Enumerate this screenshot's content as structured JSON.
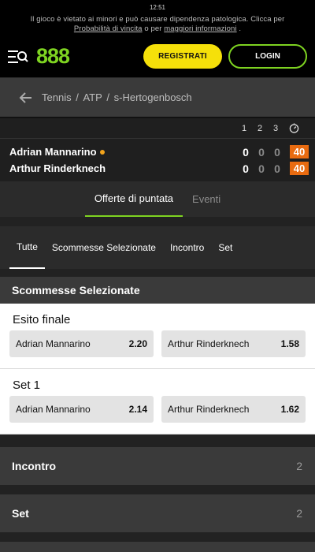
{
  "status": {
    "time": "12:51"
  },
  "disclaimer": {
    "text1": "Il gioco è vietato ai minori e può causare dipendenza patologica. Clicca per",
    "link1": "Probabilità di vincita",
    "mid": "o per",
    "link2": "maggiori informazioni",
    "end": "."
  },
  "header": {
    "logo": "888",
    "register_label": "REGISTRATI",
    "login_label": "LOGIN"
  },
  "breadcrumb": [
    "Tennis",
    "ATP",
    "s-Hertogenbosch"
  ],
  "score_header": [
    "1",
    "2",
    "3"
  ],
  "players": [
    {
      "name": "Adrian Mannarino",
      "serving": true,
      "sets": [
        "0",
        "0",
        "0"
      ],
      "points": "40"
    },
    {
      "name": "Arthur Rinderknech",
      "serving": false,
      "sets": [
        "0",
        "0",
        "0"
      ],
      "points": "40"
    }
  ],
  "tabs": {
    "offers": "Offerte di puntata",
    "events": "Eventi"
  },
  "filters": [
    "Tutte",
    "Scommesse Selezionate",
    "Incontro",
    "Set"
  ],
  "section_title": "Scommesse Selezionate",
  "markets": [
    {
      "title": "Esito finale",
      "odds": [
        {
          "selection": "Adrian Mannarino",
          "price": "2.20"
        },
        {
          "selection": "Arthur Rinderknech",
          "price": "1.58"
        }
      ]
    },
    {
      "title": "Set 1",
      "odds": [
        {
          "selection": "Adrian Mannarino",
          "price": "2.14"
        },
        {
          "selection": "Arthur Rinderknech",
          "price": "1.62"
        }
      ]
    }
  ],
  "collapsed": [
    {
      "title": "Incontro",
      "count": "2"
    },
    {
      "title": "Set",
      "count": "2"
    }
  ],
  "colors": {
    "accent_green": "#7ed321",
    "register_yellow": "#f5e00a",
    "points_orange": "#e96b10",
    "serve_dot": "#f2a41c"
  }
}
